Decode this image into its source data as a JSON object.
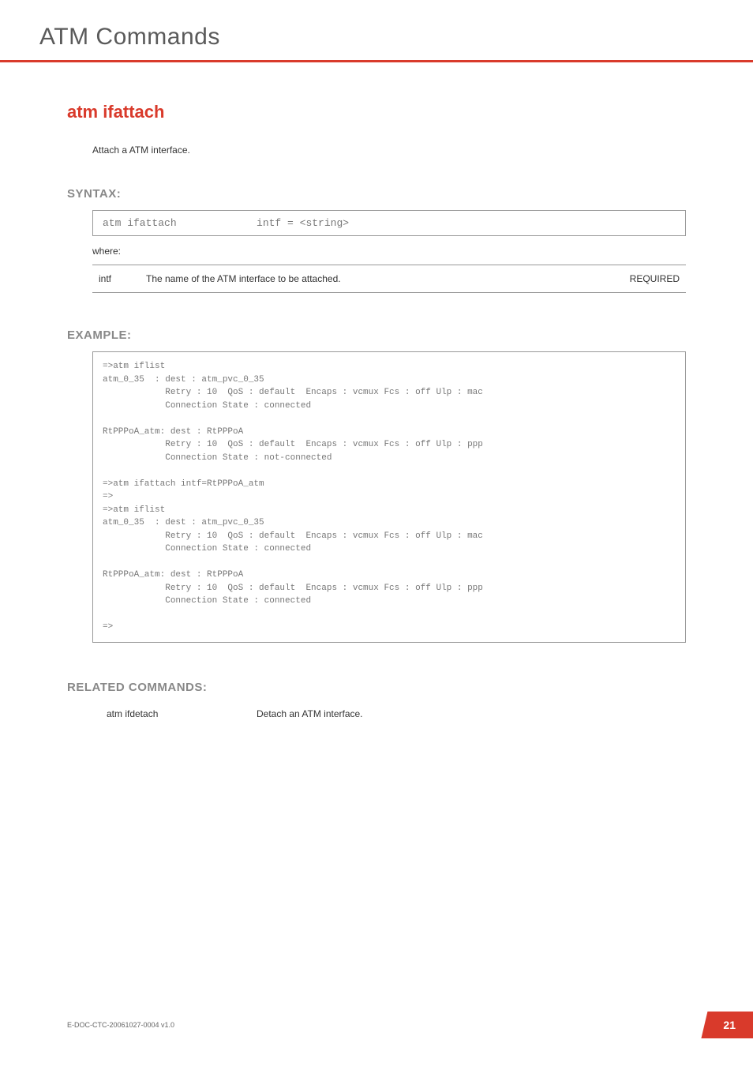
{
  "header": {
    "title": "ATM Commands"
  },
  "command": {
    "title": "atm ifattach",
    "description": "Attach a ATM interface."
  },
  "syntax": {
    "heading": "SYNTAX:",
    "code": "atm ifattach             intf = <string>",
    "where": "where:",
    "params": [
      {
        "name": "intf",
        "desc": "The name of the ATM interface to be attached.",
        "req": "REQUIRED"
      }
    ]
  },
  "example": {
    "heading": "EXAMPLE:",
    "code": "=>atm iflist\natm_0_35  : dest : atm_pvc_0_35\n            Retry : 10  QoS : default  Encaps : vcmux Fcs : off Ulp : mac\n            Connection State : connected\n\nRtPPPoA_atm: dest : RtPPPoA\n            Retry : 10  QoS : default  Encaps : vcmux Fcs : off Ulp : ppp\n            Connection State : not-connected\n\n=>atm ifattach intf=RtPPPoA_atm\n=>\n=>atm iflist\natm_0_35  : dest : atm_pvc_0_35\n            Retry : 10  QoS : default  Encaps : vcmux Fcs : off Ulp : mac\n            Connection State : connected\n\nRtPPPoA_atm: dest : RtPPPoA\n            Retry : 10  QoS : default  Encaps : vcmux Fcs : off Ulp : ppp\n            Connection State : connected\n\n=>"
  },
  "related": {
    "heading": "RELATED COMMANDS:",
    "items": [
      {
        "cmd": "atm ifdetach",
        "desc": "Detach an ATM interface."
      }
    ]
  },
  "footer": {
    "docid": "E-DOC-CTC-20061027-0004 v1.0",
    "page": "21"
  }
}
